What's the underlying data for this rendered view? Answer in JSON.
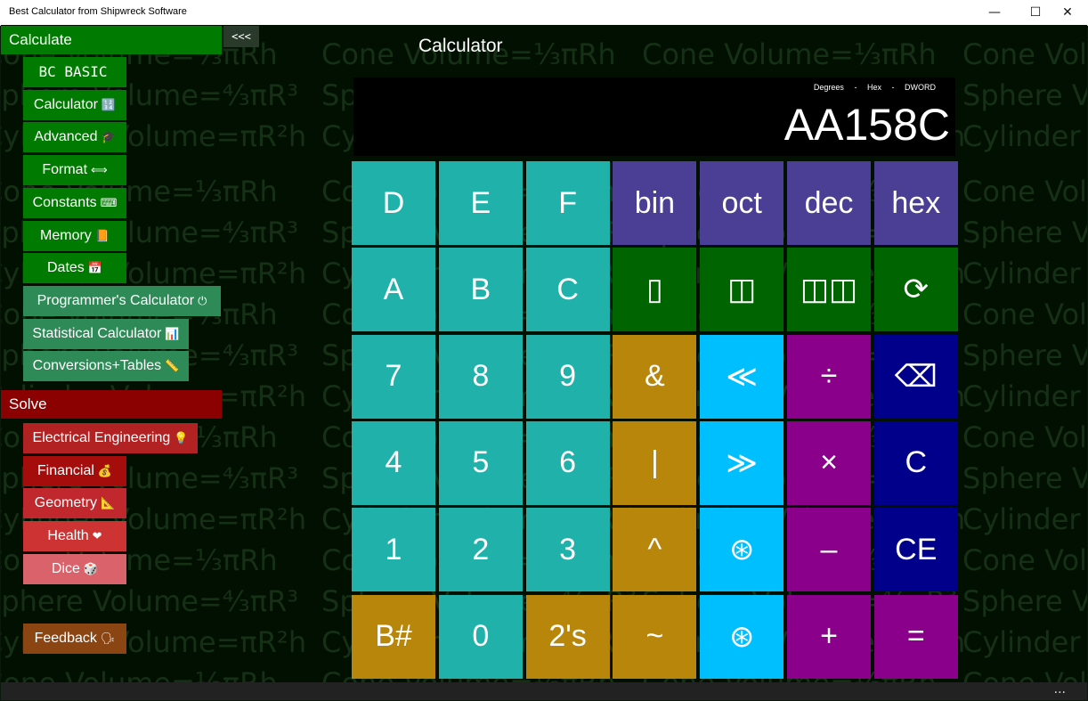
{
  "window": {
    "title": "Best Calculator from Shipwreck Software",
    "min": "—",
    "max": "☐",
    "close": "✕"
  },
  "header": {
    "title": "Calculator",
    "collapse": "<<<"
  },
  "watermark": {
    "cone": "Cone Volume=⅓πRh",
    "sphere": "Sphere Volume=⁴⁄₃πR³",
    "cylinder": "Cylinder Volume=πR²h"
  },
  "sidebar": {
    "calculate_label": "Calculate",
    "calculate_items": [
      {
        "label": "BC BASIC",
        "icon": ""
      },
      {
        "label": "Calculator",
        "icon": "🔢"
      },
      {
        "label": "Advanced",
        "icon": "🎓"
      },
      {
        "label": "Format",
        "icon": "⟺"
      },
      {
        "label": "Constants",
        "icon": "⌨"
      },
      {
        "label": "Memory",
        "icon": "📙"
      },
      {
        "label": "Dates",
        "icon": "📅"
      },
      {
        "label": "Programmer's Calculator",
        "icon": "⏻"
      },
      {
        "label": "Statistical Calculator",
        "icon": "📊"
      },
      {
        "label": "Conversions+Tables",
        "icon": "📏"
      }
    ],
    "solve_label": "Solve",
    "solve_items": [
      {
        "label": "Electrical Engineering",
        "icon": "💡"
      },
      {
        "label": "Financial",
        "icon": "💰"
      },
      {
        "label": "Geometry",
        "icon": "📐"
      },
      {
        "label": "Health",
        "icon": "❤"
      },
      {
        "label": "Dice",
        "icon": "🎲"
      }
    ],
    "feedback": {
      "label": "Feedback",
      "icon": "🗣"
    }
  },
  "display": {
    "angle_mode": "Degrees",
    "sep1": "-",
    "base_mode": "Hex",
    "sep2": "-",
    "word_size": "DWORD",
    "value": "AA158C"
  },
  "keys": [
    [
      "D",
      "E",
      "F",
      "bin",
      "oct",
      "dec",
      "hex"
    ],
    [
      "A",
      "B",
      "C",
      "▯",
      "◫",
      "◫◫",
      "⟳"
    ],
    [
      "7",
      "8",
      "9",
      "&",
      "≪",
      "÷",
      "⌫"
    ],
    [
      "4",
      "5",
      "6",
      "|",
      "≫",
      "×",
      "C"
    ],
    [
      "1",
      "2",
      "3",
      "^",
      "⊛",
      "–",
      "CE"
    ],
    [
      "B#",
      "0",
      "2's",
      "~",
      "⊛",
      "+",
      "="
    ]
  ],
  "statusbar": {
    "more": "..."
  },
  "colors": {
    "teal": "#20b2aa",
    "purple": "#4a3f94",
    "green": "#006400",
    "gold": "#b8860b",
    "sky": "#00bfff",
    "magenta": "#8b008b",
    "navy": "#00008b"
  }
}
